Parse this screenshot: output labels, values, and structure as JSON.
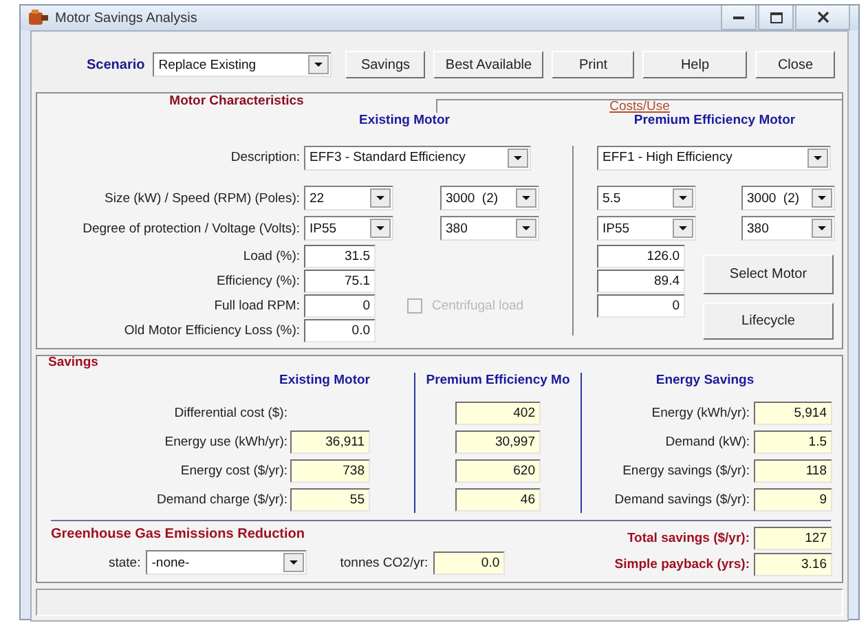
{
  "window": {
    "title": "Motor Savings Analysis"
  },
  "toolbar": {
    "scenario_label": "Scenario",
    "scenario": "Replace Existing",
    "buttons": [
      "Savings",
      "Best Available",
      "Print",
      "Help",
      "Close"
    ]
  },
  "motor": {
    "title": "Motor Characteristics",
    "costs_tab": "Costs/Use",
    "existing_header": "Existing Motor",
    "premium_header": "Premium Efficiency Motor",
    "rows": [
      {
        "kind": "description",
        "label": "Description:",
        "existing": [
          "EFF3 - Standard Efficiency"
        ],
        "premium": [
          "EFF1 - High Efficiency"
        ]
      },
      {
        "kind": "combos",
        "label": "Size (kW) / Speed (RPM) (Poles):",
        "existing": [
          "22",
          "3000  (2)"
        ],
        "premium": [
          "5.5",
          "3000  (2)"
        ]
      },
      {
        "kind": "combos",
        "label": "Degree of protection / Voltage (Volts):",
        "existing": [
          "IP55",
          "380"
        ],
        "premium": [
          "IP55",
          "380"
        ]
      },
      {
        "kind": "field",
        "label": "Load (%):",
        "existing": "31.5",
        "premium": "126.0"
      },
      {
        "kind": "field",
        "label": "Efficiency (%):",
        "existing": "75.1",
        "premium": "89.4"
      },
      {
        "kind": "field",
        "label": "Full load RPM:",
        "existing": "0",
        "premium": "0",
        "option": {
          "label": "Centrifugal load",
          "checked": false,
          "disabled": true
        }
      },
      {
        "kind": "field",
        "label": "Old Motor Efficiency Loss (%):",
        "existing": "0.0"
      }
    ],
    "buttons": [
      "Select Motor",
      "Lifecycle"
    ]
  },
  "savings": {
    "title": "Savings",
    "existing_header": "Existing Motor",
    "premium_header": "Premium Efficiency Mo",
    "energy_header": "Energy Savings",
    "rows": [
      {
        "label": "Differential cost ($):",
        "premium": "402"
      },
      {
        "label": "Energy use (kWh/yr):",
        "existing": "36,911",
        "premium": "30,997"
      },
      {
        "label": "Energy cost ($/yr):",
        "existing": "738",
        "premium": "620"
      },
      {
        "label": "Demand charge ($/yr):",
        "existing": "55",
        "premium": "46"
      }
    ],
    "energy_rows": [
      {
        "label": "Energy (kWh/yr):",
        "value": "5,914"
      },
      {
        "label": "Demand (kW):",
        "value": "1.5"
      },
      {
        "label": "Energy savings ($/yr):",
        "value": "118"
      },
      {
        "label": "Demand savings ($/yr):",
        "value": "9"
      }
    ]
  },
  "emissions": {
    "title": "Greenhouse Gas Emissions Reduction",
    "state_label": "state:",
    "state": "-none-",
    "tonnes_label": "tonnes CO2/yr:",
    "tonnes": "0.0"
  },
  "totals": [
    {
      "label": "Total savings ($/yr):",
      "value": "127"
    },
    {
      "label": "Simple payback (yrs):",
      "value": "3.16"
    }
  ]
}
